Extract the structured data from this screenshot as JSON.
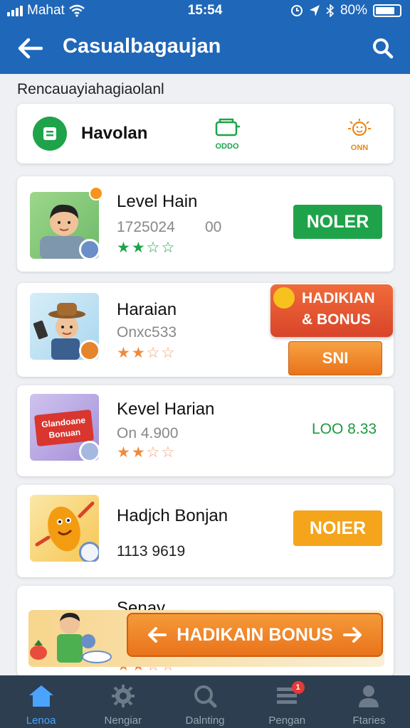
{
  "status_bar": {
    "carrier": "Mahat",
    "time": "15:54",
    "battery": "80%",
    "battery_level": 0.8
  },
  "header": {
    "title": "Casualbagaujan",
    "back_icon": "arrow-left-icon",
    "search_icon": "search-icon"
  },
  "section_label": "Rencauayiahagiaolanl",
  "info_card": {
    "title": "Havolan",
    "icon_left": "list-icon",
    "mini_icon_1_label": "ODDO",
    "mini_icon_2_label": "ONN"
  },
  "games": [
    {
      "title": "Level Hain",
      "sub": "1725024",
      "extra": "00",
      "stars": 2,
      "button": "NOLER"
    },
    {
      "title": "Haraian",
      "sub": "Onxc533",
      "stars": 2,
      "promo_line1": "HADIKIAN",
      "promo_line2": "& BONUS",
      "button": "SNI"
    },
    {
      "title": "Kevel Harian",
      "sub": "On 4.900",
      "stars": 2,
      "value": "LOO 8.33",
      "thumb_text_line1": "Glandoane",
      "thumb_text_line2": "Bonuan"
    },
    {
      "title": "Hadjch Bonjan",
      "sub": "1113 9619",
      "button": "NOIER"
    },
    {
      "title": "Senay",
      "stars": 2
    }
  ],
  "overlay": {
    "label": "HADIKAIN BONUS"
  },
  "bottom_nav": [
    {
      "label": "Lenoa",
      "icon": "home-icon",
      "active": true
    },
    {
      "label": "Nengiar",
      "icon": "cog-icon",
      "active": false
    },
    {
      "label": "Dalnting",
      "icon": "search-circle-icon",
      "active": false
    },
    {
      "label": "Pengan",
      "icon": "list-icon",
      "active": false,
      "badge": "1"
    },
    {
      "label": "Ftaries",
      "icon": "user-icon",
      "active": false
    }
  ],
  "colors": {
    "header_blue": "#1f67b8",
    "green": "#1ea34a",
    "orange": "#f39c12",
    "promo_red": "#e2552a",
    "nav_bg": "#2c3e50",
    "nav_active": "#4aa3ff"
  }
}
